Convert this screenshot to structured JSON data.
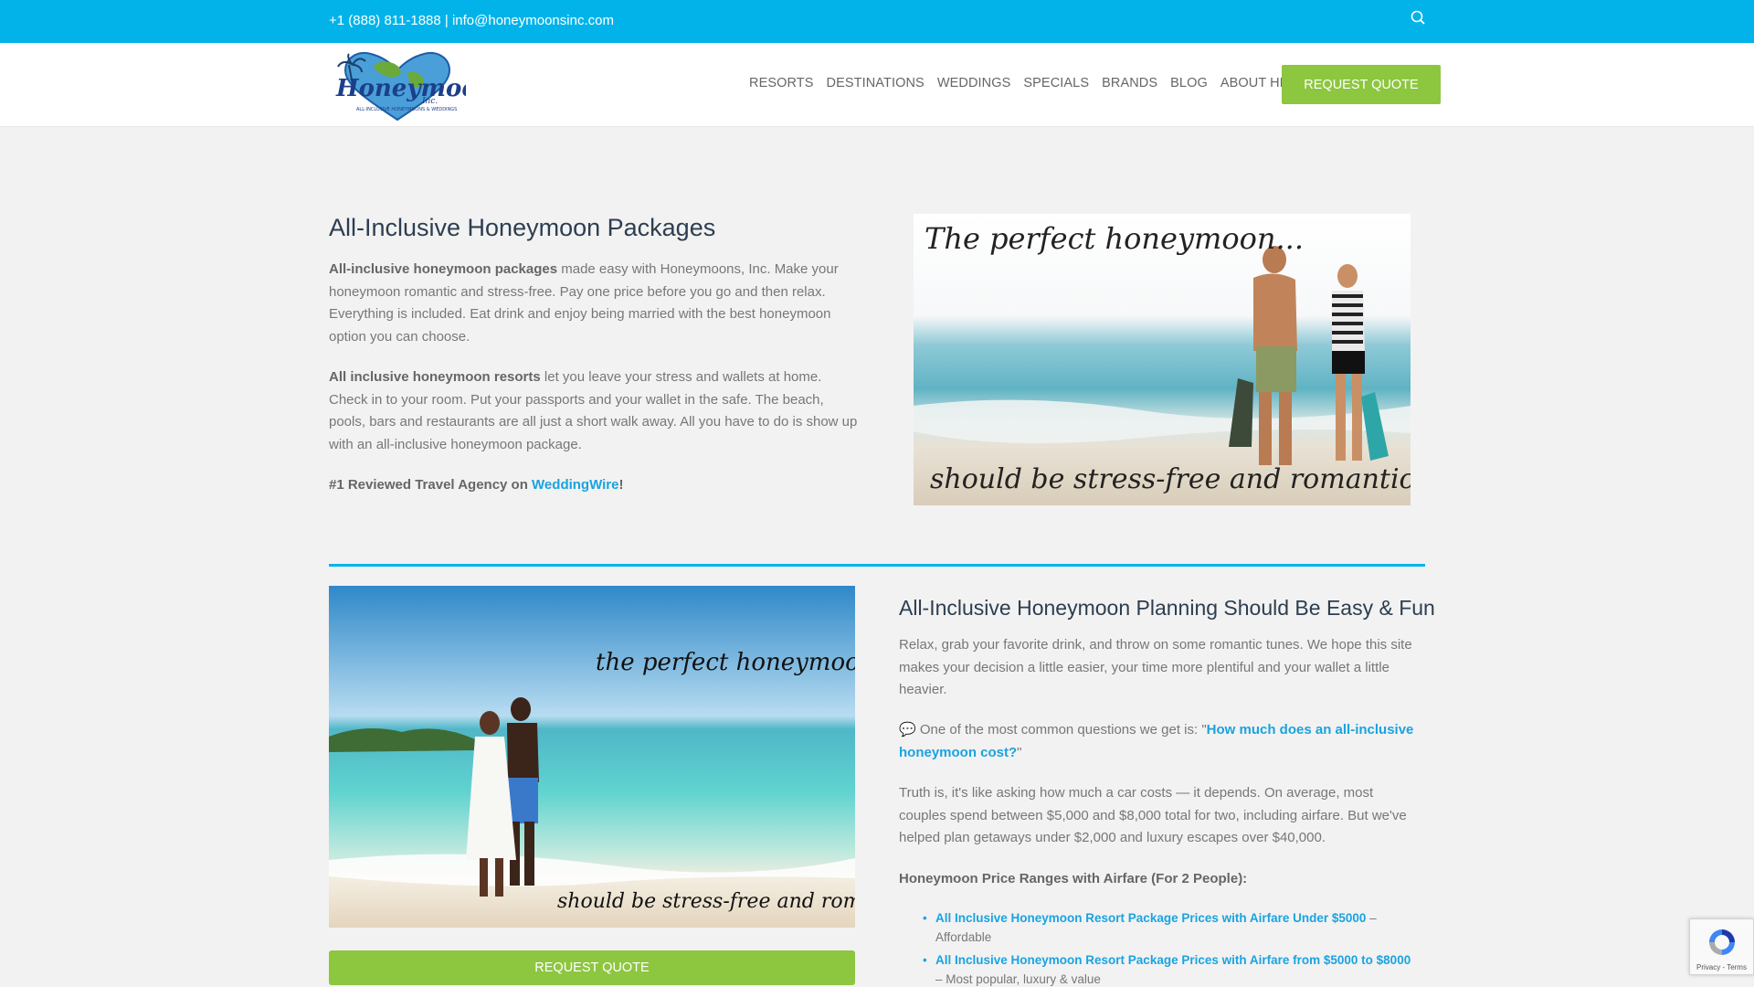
{
  "topbar": {
    "contact": "+1 (888) 811-1888 | info@honeymoonsinc.com",
    "search_icon": "search-icon"
  },
  "header": {
    "logo_text": "Honeymoons, Inc.",
    "nav": [
      "RESORTS",
      "DESTINATIONS",
      "WEDDINGS",
      "SPECIALS",
      "BRANDS",
      "BLOG",
      "ABOUT HMI"
    ],
    "cta": "REQUEST QUOTE"
  },
  "section1": {
    "title": "All-Inclusive Honeymoon Packages",
    "p1_bold": "All-inclusive honeymoon packages",
    "p1_rest": " made easy with Honeymoons, Inc. Make your honeymoon romantic and stress-free. Pay one price before you go and then relax. Everything is included. Eat drink and enjoy being married with the best honeymoon option you can choose.",
    "p2_bold": "All inclusive honeymoon resorts",
    "p2_rest": " let you leave your stress and wallets at home. Check in to your room. Put your passports and your wallet in the safe. The beach, pools, bars and restaurants are all just a short walk away. All you have to do is show up with an all-inclusive honeymoon package.",
    "p3_bold": "#1 Reviewed Travel Agency on ",
    "p3_link": "WeddingWire",
    "p3_end": "!",
    "image_caption_top": "The perfect honeymoon...",
    "image_caption_bottom": "should be stress-free and romantic"
  },
  "section2": {
    "image_caption_top": "the perfect honeymoon",
    "image_caption_bottom": "should be stress-free and romantic",
    "cta": "REQUEST QUOTE",
    "title": "All-Inclusive Honeymoon Planning Should Be Easy & Fun",
    "p1": "Relax, grab your favorite drink, and throw on some romantic tunes. We hope this site makes your decision a little easier, your time more plentiful and your wallet a little heavier.",
    "p2_pre": " One of the most common questions we get is: \"",
    "p2_link": "How much does an all-inclusive honeymoon cost?",
    "p2_end": "\"",
    "p3": "Truth is, it's like asking how much a car costs — it depends. On average, most couples spend between $5,000 and $8,000 total for two, including airfare. But we've helped plan getaways under $2,000 and luxury escapes over $40,000.",
    "p4": "Honeymoon Price Ranges with Airfare (For 2 People):",
    "list": [
      {
        "link": "All Inclusive Honeymoon Resort Package Prices with Airfare Under $5000",
        "desc": " – Affordable"
      },
      {
        "link": "All Inclusive Honeymoon Resort Package Prices with Airfare from $5000 to $8000",
        "desc": " – Most popular, luxury & value"
      }
    ]
  },
  "recaptcha": {
    "text": "Privacy - Terms"
  },
  "colors": {
    "topbar": "#02b3ea",
    "accent_green": "#8dc63f",
    "link": "#1aa3e0",
    "heading": "#2d3e50"
  }
}
